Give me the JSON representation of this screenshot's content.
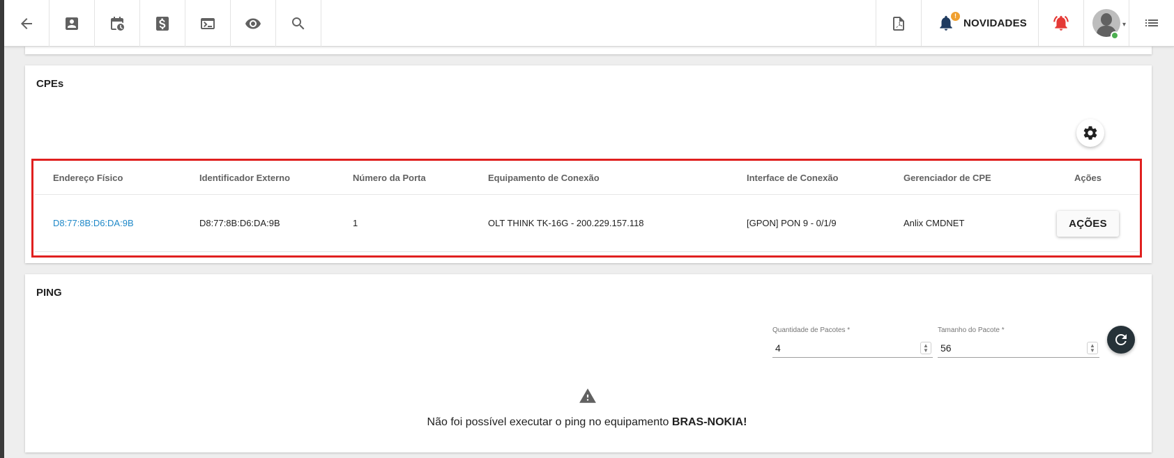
{
  "toolbar": {
    "left_icons": [
      "back-arrow-icon",
      "contact-card-icon",
      "calendar-clock-icon",
      "dollar-icon",
      "terminal-icon",
      "eye-icon",
      "search-icon"
    ],
    "right": {
      "pdf_icon": "pdf-icon",
      "news_label": "NOVIDADES",
      "news_badge": "!",
      "alarm_icon": "alarm-bell-icon",
      "menu_icon": "list-menu-icon"
    }
  },
  "cpes": {
    "title": "CPEs",
    "columns": [
      "Endereço Físico",
      "Identificador Externo",
      "Número da Porta",
      "Equipamento de Conexão",
      "Interface de Conexão",
      "Gerenciador de CPE",
      "Ações"
    ],
    "rows": [
      {
        "mac": "D8:77:8B:D6:DA:9B",
        "external_id": "D8:77:8B:D6:DA:9B",
        "port": "1",
        "equipment": "OLT THINK TK-16G - 200.229.157.118",
        "interface": "[GPON] PON 9 - 0/1/9",
        "manager": "Anlix CMDNET",
        "action_label": "AÇÕES"
      }
    ]
  },
  "ping": {
    "title": "PING",
    "packets_label": "Quantidade de Pacotes *",
    "packets_value": "4",
    "size_label": "Tamanho do Pacote *",
    "size_value": "56",
    "error_prefix": "Não foi possível executar o ping no equipamento ",
    "error_device": "BRAS-NOKIA!"
  },
  "colors": {
    "highlight": "#e0201f",
    "link": "#1e88c8",
    "alarm": "#e53935",
    "refresh_button": "#263238"
  }
}
